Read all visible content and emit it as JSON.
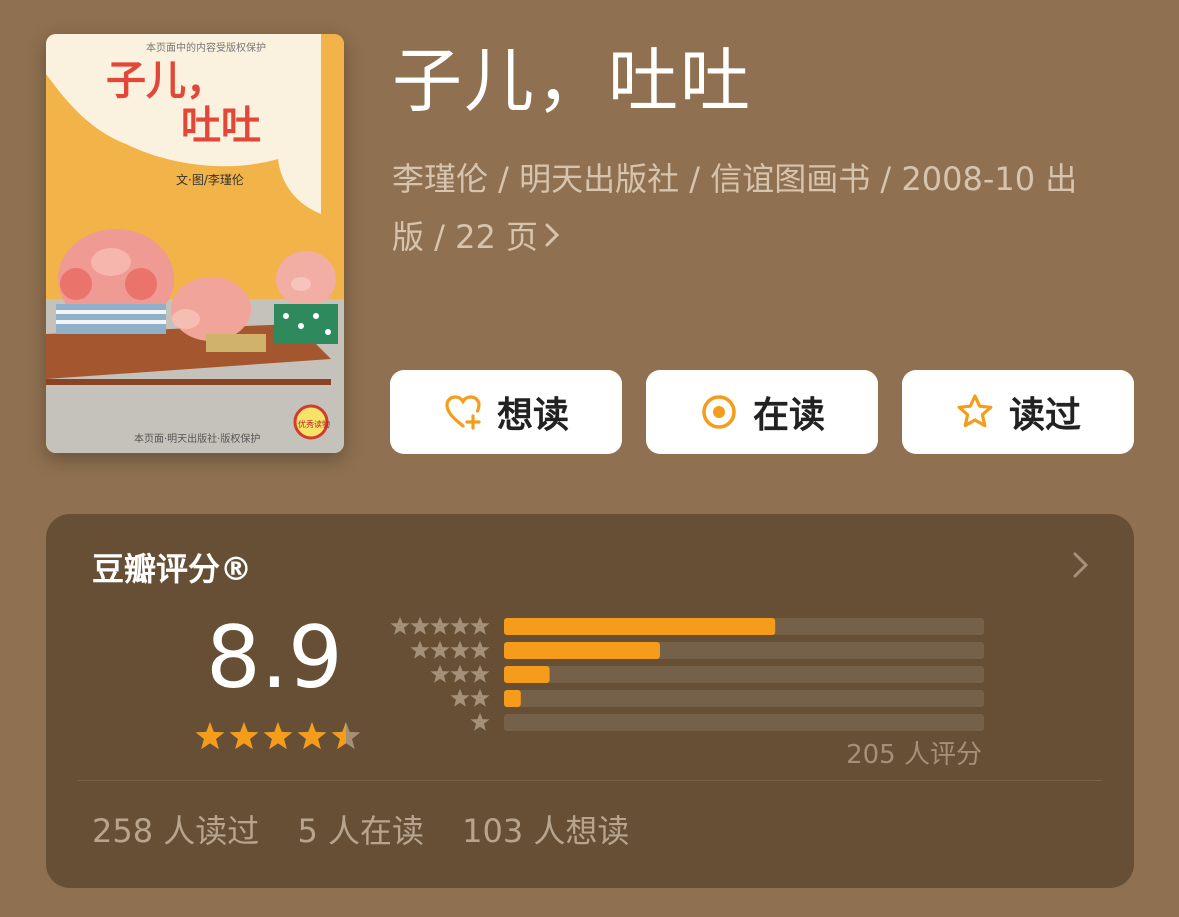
{
  "book": {
    "title": "子儿，吐吐",
    "meta_line1": "李瑾伦 / 明天出版社 / 信谊图画书 / 2008-10 出",
    "meta_line2": "版 / 22 页"
  },
  "cover": {
    "top_text": "本页面中的内容受版权保护",
    "title_line1": "子儿，",
    "title_line2": "吐吐",
    "author_text": "文·图/李瑾伦",
    "badge": "优秀读物",
    "bottom_text": "本页面·明天出版社·版权保护"
  },
  "actions": {
    "want_label": "想读",
    "reading_label": "在读",
    "read_label": "读过",
    "icons": [
      "heart-plus-icon",
      "target-circle-icon",
      "star-outline-icon"
    ]
  },
  "rating": {
    "title": "豆瓣评分®",
    "score": "8.9",
    "stars": 4.5,
    "distribution": [
      {
        "stars": 5,
        "fraction": 0.565
      },
      {
        "stars": 4,
        "fraction": 0.325
      },
      {
        "stars": 3,
        "fraction": 0.095
      },
      {
        "stars": 2,
        "fraction": 0.035
      },
      {
        "stars": 1,
        "fraction": 0.0
      }
    ],
    "count_text": "205 人评分"
  },
  "stats": {
    "read": "258 人读过",
    "reading": "5 人在读",
    "want": "103 人想读"
  },
  "colors": {
    "background": "#8f7050",
    "panel": "#664f35",
    "accent": "#f59c1a",
    "bar_track": "#75604a"
  }
}
